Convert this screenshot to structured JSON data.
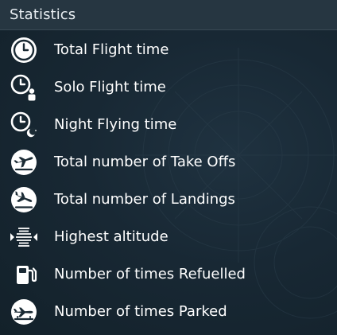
{
  "header": {
    "title": "Statistics"
  },
  "stats": [
    {
      "label": "Total Flight time",
      "icon": "stopwatch-icon"
    },
    {
      "label": "Solo Flight time",
      "icon": "clock-person-icon"
    },
    {
      "label": "Night Flying time",
      "icon": "clock-moon-icon"
    },
    {
      "label": "Total number of Take Offs",
      "icon": "takeoff-icon"
    },
    {
      "label": "Total number of Landings",
      "icon": "landing-icon"
    },
    {
      "label": "Highest altitude",
      "icon": "altitude-icon"
    },
    {
      "label": "Number of times Refuelled",
      "icon": "fuel-pump-icon"
    },
    {
      "label": "Number of times Parked",
      "icon": "parked-plane-icon"
    }
  ],
  "colors": {
    "background": "#15232b",
    "header": "#263641",
    "text": "#ffffff"
  }
}
